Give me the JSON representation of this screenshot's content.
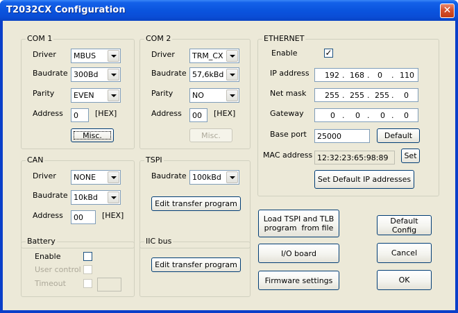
{
  "window": {
    "title": "T2032CX Configuration",
    "close_glyph": "✕"
  },
  "com1": {
    "legend": "COM 1",
    "driver_label": "Driver",
    "driver": "MBUS",
    "baud_label": "Baudrate",
    "baud": "300Bd",
    "parity_label": "Parity",
    "parity": "EVEN",
    "address_label": "Address",
    "address": "0",
    "hex": "[HEX]",
    "misc": "Misc."
  },
  "com2": {
    "legend": "COM 2",
    "driver_label": "Driver",
    "driver": "TRM_CX",
    "baud_label": "Baudrate",
    "baud": "57,6kBd",
    "parity_label": "Parity",
    "parity": "NO",
    "address_label": "Address",
    "address": "00",
    "hex": "[HEX]",
    "misc": "Misc."
  },
  "can": {
    "legend": "CAN",
    "driver_label": "Driver",
    "driver": "NONE",
    "baud_label": "Baudrate",
    "baud": "10kBd",
    "address_label": "Address",
    "address": "00",
    "hex": "[HEX]"
  },
  "tspi": {
    "legend": "TSPI",
    "baud_label": "Baudrate",
    "baud": "100kBd",
    "edit": "Edit transfer program"
  },
  "battery": {
    "legend": "Battery",
    "enable": "Enable",
    "user_control": "User control",
    "timeout": "Timeout"
  },
  "iic": {
    "legend": "IIC bus",
    "edit": "Edit transfer program"
  },
  "ethernet": {
    "legend": "ETHERNET",
    "enable_label": "Enable",
    "enable_check": "✓",
    "ip_label": "IP address",
    "ip": [
      "192",
      "168",
      "0",
      "110"
    ],
    "mask_label": "Net mask",
    "mask": [
      "255",
      "255",
      "255",
      "0"
    ],
    "gw_label": "Gateway",
    "gw": [
      "0",
      "0",
      "0",
      "0"
    ],
    "port_label": "Base port",
    "port": "25000",
    "default": "Default",
    "mac_label": "MAC address",
    "mac": "12:32:23:65:98:89",
    "set": "Set",
    "set_default_ip": "Set Default IP addresses"
  },
  "buttons": {
    "load_tspi_line1": "Load TSPI and TLB",
    "load_tspi_line2": "program  from file",
    "io_board": "I/O board",
    "firmware": "Firmware settings",
    "default_config": "Default Config",
    "cancel": "Cancel",
    "ok": "OK"
  },
  "colors": {
    "title_bar": "#0a54de",
    "dialog_bg": "#ece9d8",
    "close_button": "#d5502c"
  }
}
